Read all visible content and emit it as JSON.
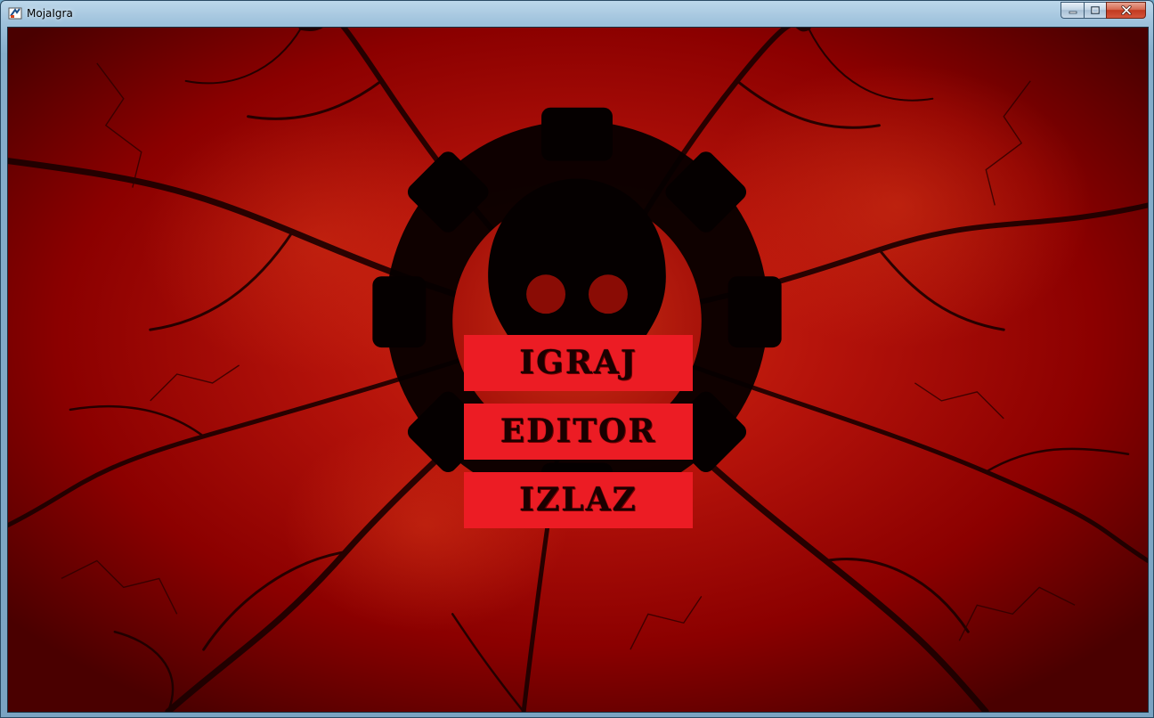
{
  "window": {
    "title": "MojaIgra",
    "icon": "java-app-icon",
    "caption_buttons": [
      "minimize-icon",
      "maximize-icon",
      "close-icon"
    ]
  },
  "background": {
    "image": "red-veined-gear-skull-emblem",
    "colors": {
      "base": "#8b0000",
      "veins": "#1a0000",
      "glow": "#d42a14"
    }
  },
  "menu": {
    "buttons": [
      {
        "label": "IGRAJ"
      },
      {
        "label": "EDITOR"
      },
      {
        "label": "IZLAZ"
      }
    ],
    "button_color": "#ec1c24",
    "text_color": "#1a0000"
  }
}
